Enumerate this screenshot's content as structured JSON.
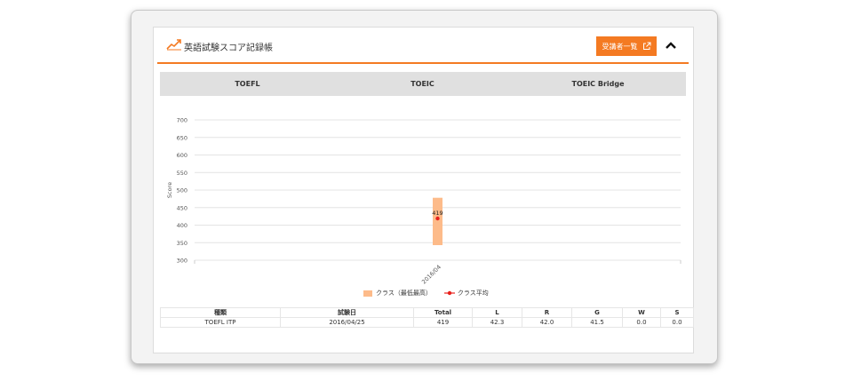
{
  "header": {
    "title": "英語試験スコア記録帳",
    "title_icon": "line-chart-icon",
    "list_button_label": "受講者一覧",
    "list_button_icon": "external-link-icon",
    "collapse_icon": "chevron-up-icon",
    "accent_color": "#f47a22"
  },
  "tabs": [
    {
      "label": "TOEFL",
      "active": true
    },
    {
      "label": "TOEIC",
      "active": false
    },
    {
      "label": "TOEIC Bridge",
      "active": false
    }
  ],
  "tab_active_color": "#6e7cf5",
  "chart_data": {
    "type": "bar",
    "ylabel": "Score",
    "ylim": [
      300,
      700
    ],
    "yticks": [
      700,
      650,
      600,
      550,
      500,
      450,
      400,
      350,
      300
    ],
    "categories": [
      "2016/04"
    ],
    "series": [
      {
        "name": "クラス（最低最高）",
        "type": "range",
        "low": [
          343
        ],
        "high": [
          478
        ],
        "color": "#fdbb8a"
      },
      {
        "name": "クラス平均",
        "type": "line",
        "values": [
          419
        ],
        "color": "#e8201c"
      }
    ],
    "data_labels": [
      "419"
    ],
    "grid": true,
    "legend_position": "bottom"
  },
  "table": {
    "headers": [
      "種類",
      "試験日",
      "Total",
      "L",
      "R",
      "G",
      "W",
      "S"
    ],
    "rows": [
      [
        "TOEFL ITP",
        "2016/04/25",
        "419",
        "42.3",
        "42.0",
        "41.5",
        "0.0",
        "0.0"
      ]
    ]
  }
}
